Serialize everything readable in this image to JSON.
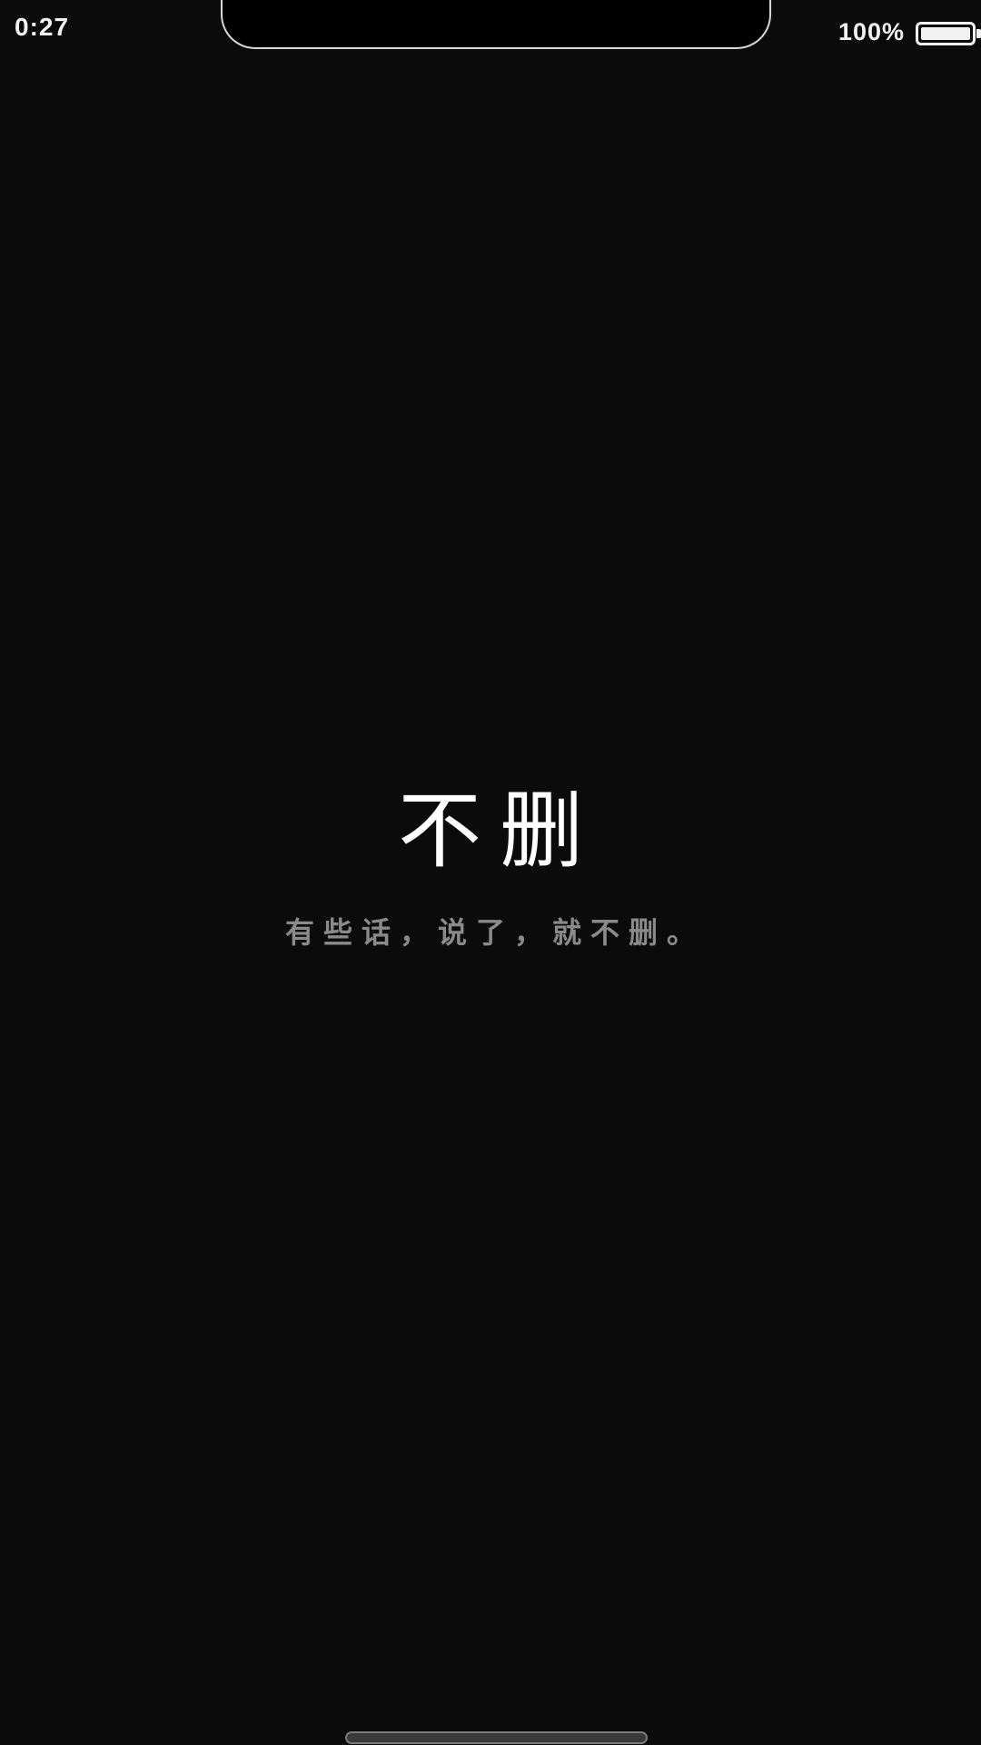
{
  "status_bar": {
    "time": "0:27",
    "battery_percent_label": "100%",
    "battery_level": 1.0
  },
  "splash": {
    "title": "不删",
    "subtitle": "有些话，说了，就不删。"
  },
  "colors": {
    "background": "#0b0b0b",
    "title": "#ffffff",
    "subtitle": "#8a8a8a",
    "status_text": "#f2f2f2"
  },
  "icons": {
    "battery": "battery-icon"
  }
}
